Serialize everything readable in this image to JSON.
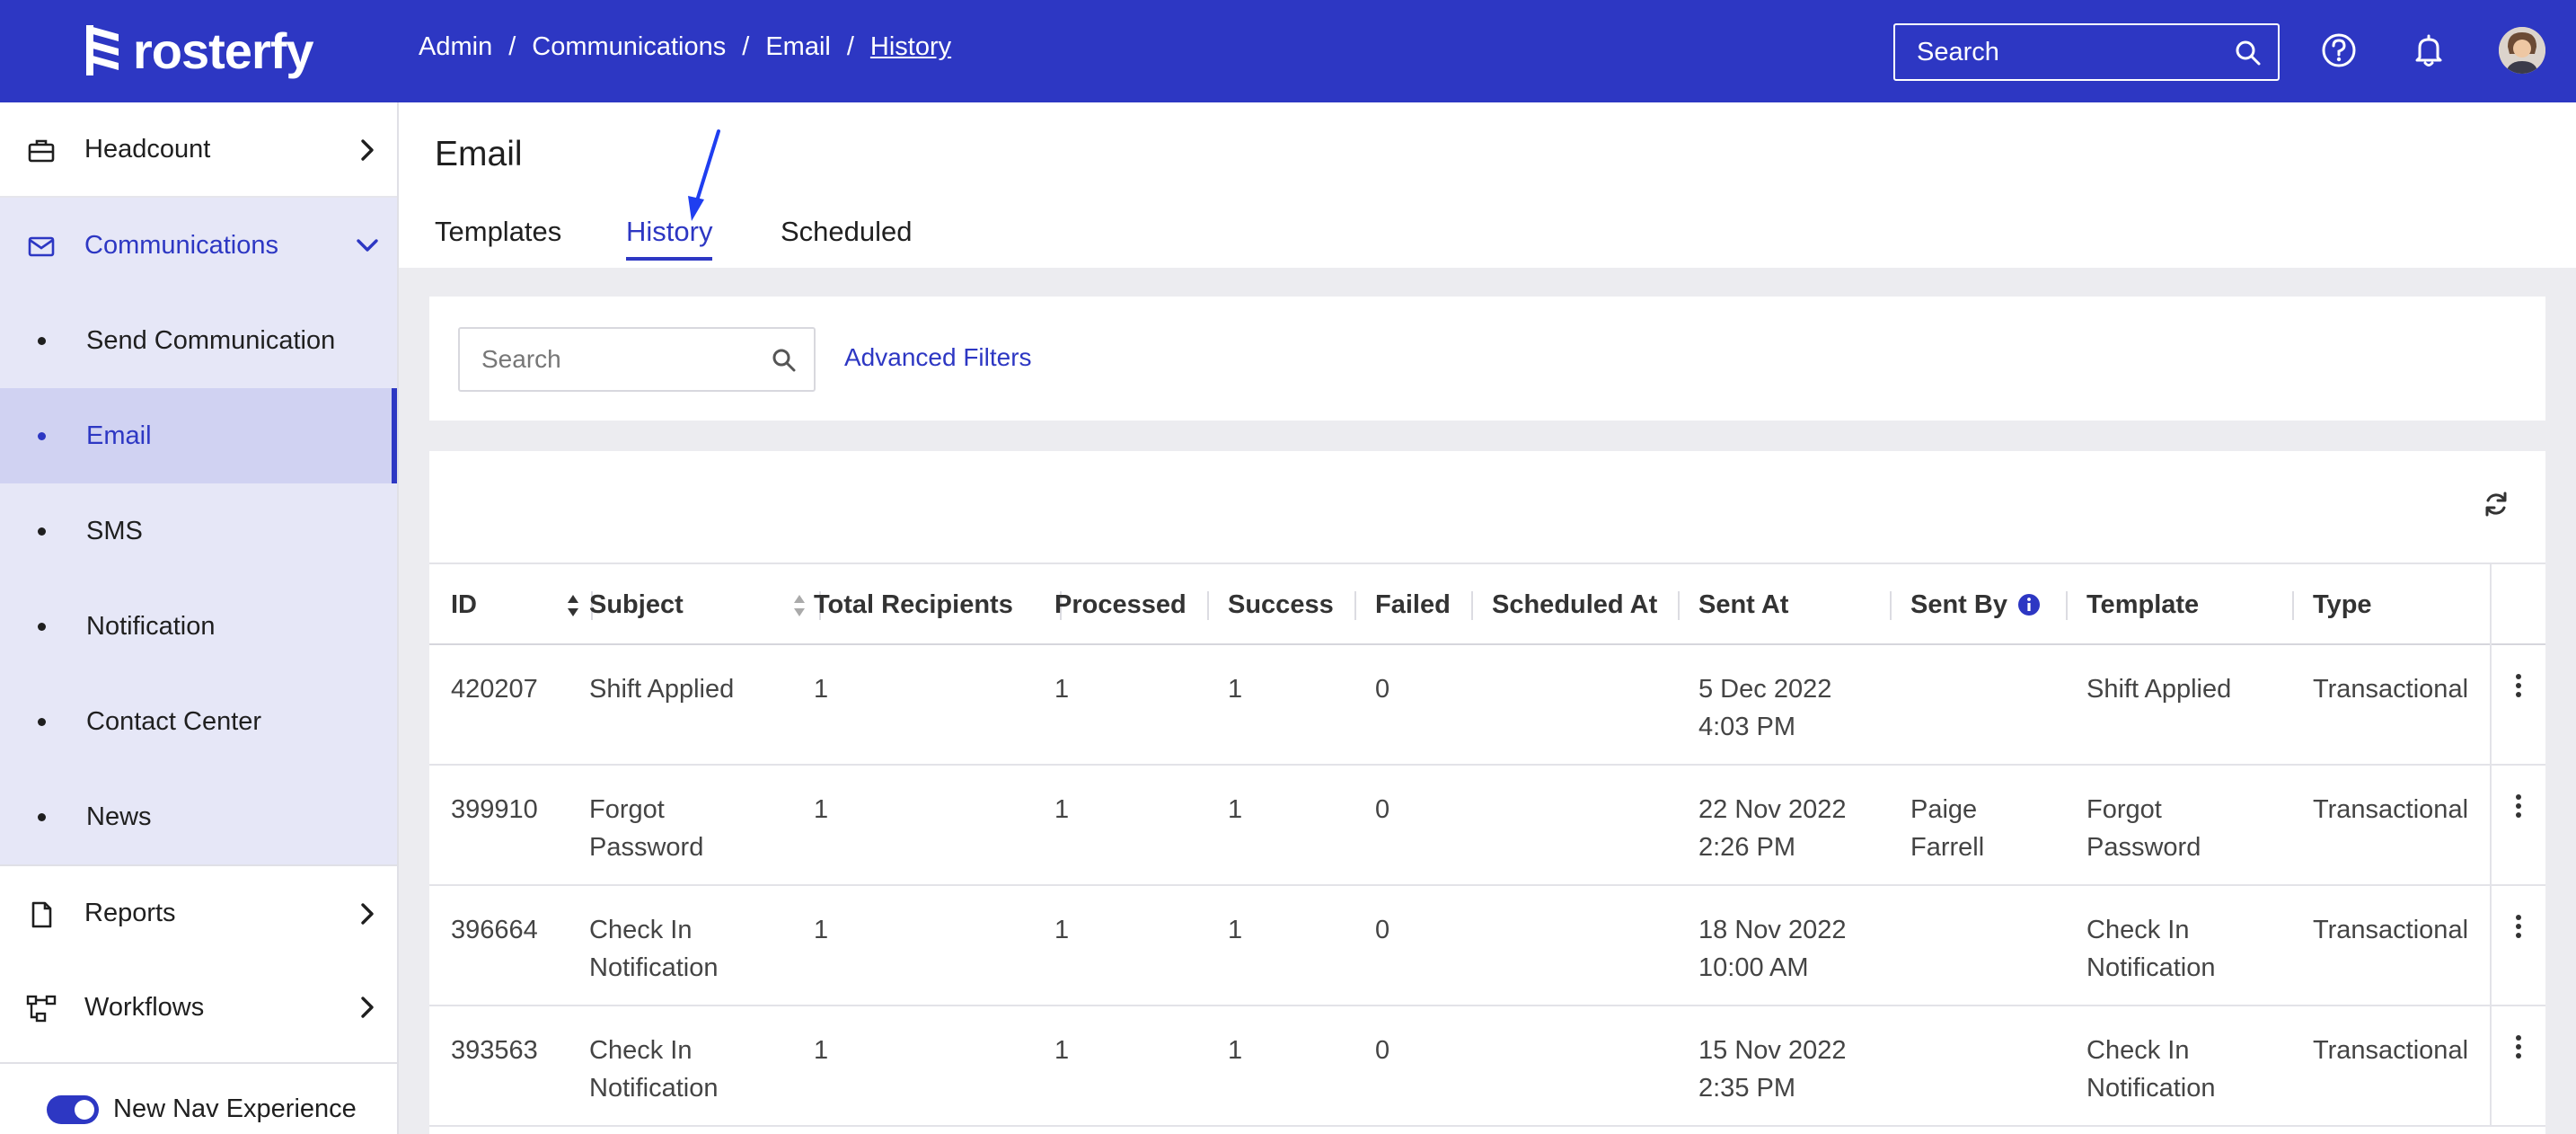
{
  "brand": {
    "name": "rosterfy"
  },
  "breadcrumbs": [
    "Admin",
    "Communications",
    "Email",
    "History"
  ],
  "header": {
    "search_placeholder": "Search"
  },
  "sidebar": {
    "items": [
      {
        "label": "Headcount",
        "icon": "briefcase-icon"
      },
      {
        "label": "Communications",
        "icon": "envelope-icon",
        "expanded": true
      },
      {
        "label": "Reports",
        "icon": "document-icon"
      },
      {
        "label": "Workflows",
        "icon": "workflow-icon"
      }
    ],
    "sub_items": [
      "Send Communication",
      "Email",
      "SMS",
      "Notification",
      "Contact Center",
      "News"
    ],
    "active_sub_item": "Email",
    "toggle_label": "New Nav Experience",
    "toggle_on": true
  },
  "page": {
    "title": "Email",
    "tabs": [
      "Templates",
      "History",
      "Scheduled"
    ],
    "active_tab": "History"
  },
  "filters": {
    "search_placeholder": "Search",
    "advanced_label": "Advanced Filters"
  },
  "table": {
    "columns": [
      "ID",
      "Subject",
      "Total Recipients",
      "Processed",
      "Success",
      "Failed",
      "Scheduled At",
      "Sent At",
      "Sent By",
      "Template",
      "Type"
    ],
    "rows": [
      {
        "id": "420207",
        "subject": [
          "Shift Applied"
        ],
        "total": "1",
        "processed": "1",
        "success": "1",
        "failed": "0",
        "scheduled_at": "",
        "sent_at": [
          "5 Dec 2022",
          "4:03 PM"
        ],
        "sent_by": [],
        "template": [
          "Shift Applied"
        ],
        "type": "Transactional"
      },
      {
        "id": "399910",
        "subject": [
          "Forgot",
          "Password"
        ],
        "total": "1",
        "processed": "1",
        "success": "1",
        "failed": "0",
        "scheduled_at": "",
        "sent_at": [
          "22 Nov 2022",
          "2:26 PM"
        ],
        "sent_by": [
          "Paige",
          "Farrell"
        ],
        "template": [
          "Forgot",
          "Password"
        ],
        "type": "Transactional"
      },
      {
        "id": "396664",
        "subject": [
          "Check In",
          "Notification"
        ],
        "total": "1",
        "processed": "1",
        "success": "1",
        "failed": "0",
        "scheduled_at": "",
        "sent_at": [
          "18 Nov 2022",
          "10:00 AM"
        ],
        "sent_by": [],
        "template": [
          "Check In",
          "Notification"
        ],
        "type": "Transactional"
      },
      {
        "id": "393563",
        "subject": [
          "Check In",
          "Notification"
        ],
        "total": "1",
        "processed": "1",
        "success": "1",
        "failed": "0",
        "scheduled_at": "",
        "sent_at": [
          "15 Nov 2022",
          "2:35 PM"
        ],
        "sent_by": [],
        "template": [
          "Check In",
          "Notification"
        ],
        "type": "Transactional"
      }
    ]
  },
  "colors": {
    "brand_blue": "#2d37c3",
    "sidebar_active_bg": "#d0d2f2",
    "sidebar_group_bg": "#e6e7f7",
    "annotation_arrow": "#1f3ef0"
  }
}
